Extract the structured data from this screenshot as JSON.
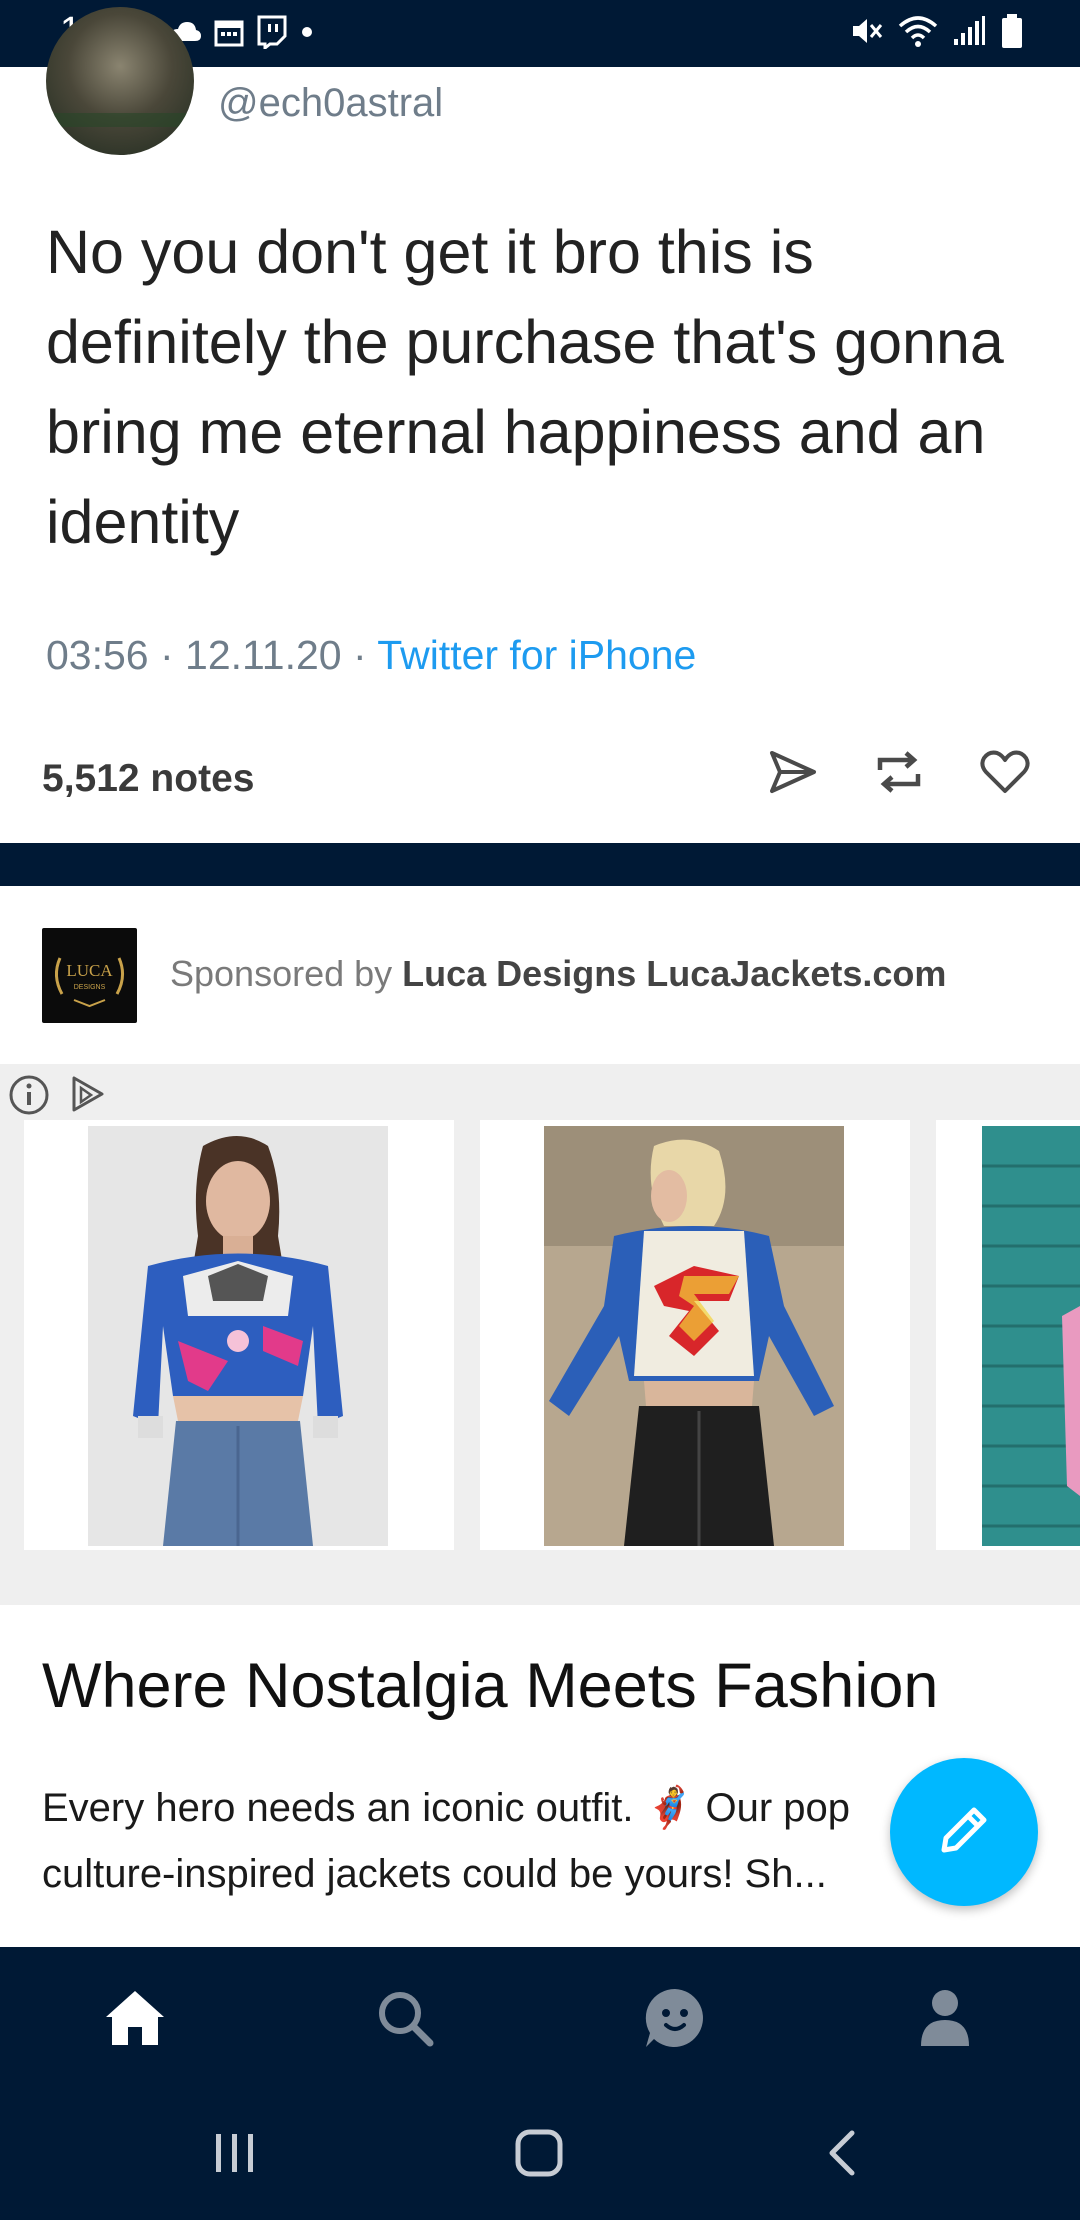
{
  "status_bar": {
    "time": "10:46",
    "left_icons": [
      "cloud-icon",
      "calendar-icon",
      "twitch-icon",
      "dot-icon"
    ],
    "right_icons": [
      "mute-icon",
      "wifi-icon",
      "signal-icon",
      "battery-icon"
    ]
  },
  "tweet": {
    "handle": "@ech0astral",
    "text": "No you don't get it bro this is definitely the purchase that's gonna bring me eternal happiness and an identity",
    "time_date": "03:56 · 12.11.20 · ",
    "source": "Twitter for iPhone"
  },
  "post_footer": {
    "notes": "5,512 notes",
    "actions": [
      "send-icon",
      "reblog-icon",
      "like-icon"
    ]
  },
  "sponsored": {
    "logo_text": "LUCA",
    "logo_subtext": "DESIGNS",
    "label": "Sponsored by ",
    "name": "Luca Designs",
    "url": "LucaJackets.com"
  },
  "ad": {
    "headline": "Where Nostalgia Meets Fashion",
    "body": "Every hero needs an iconic outfit. 🦸 Our pop culture-inspired jackets could be yours! Sh..."
  },
  "bottom_nav": {
    "items": [
      "home-icon",
      "search-icon",
      "activity-icon",
      "account-icon"
    ]
  },
  "colors": {
    "navy": "#001935",
    "accent_blue": "#00b8ff",
    "link_blue": "#1d9bf0"
  }
}
